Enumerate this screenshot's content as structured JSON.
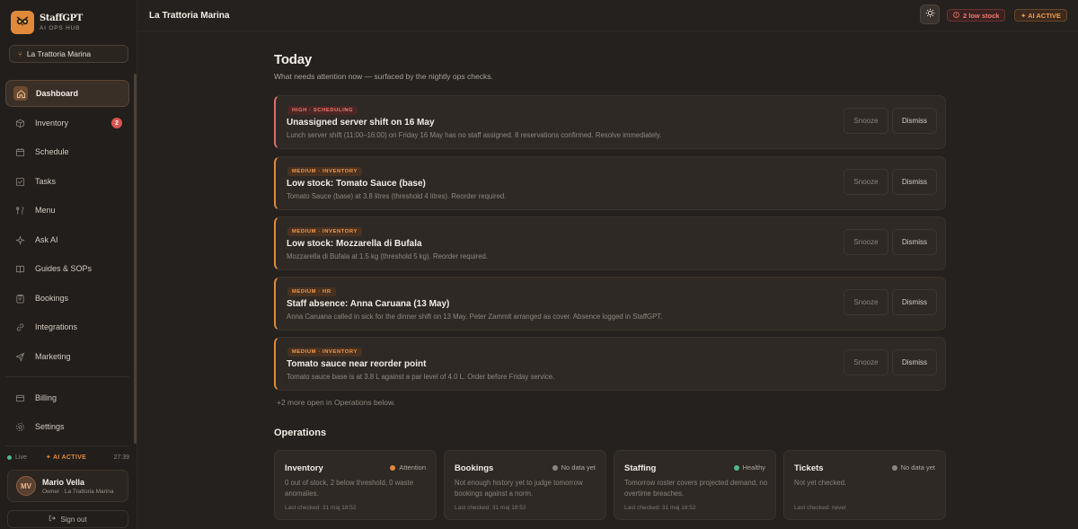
{
  "brand": {
    "name": "StaffGPT",
    "subtitle": "AI OPS HUB"
  },
  "venue_selector": {
    "value": "La Trattoria Marina",
    "icon": "fork-knife-icon"
  },
  "nav": [
    {
      "label": "Dashboard",
      "icon": "home-icon",
      "active": true
    },
    {
      "label": "Inventory",
      "icon": "box-icon",
      "badge": "2"
    },
    {
      "label": "Schedule",
      "icon": "calendar-icon"
    },
    {
      "label": "Tasks",
      "icon": "checklist-icon"
    },
    {
      "label": "Menu",
      "icon": "fork-knife-icon"
    },
    {
      "label": "Ask AI",
      "icon": "sparkle-icon"
    },
    {
      "label": "Guides & SOPs",
      "icon": "book-icon"
    },
    {
      "label": "Bookings",
      "icon": "clipboard-icon"
    },
    {
      "label": "Integrations",
      "icon": "link-icon"
    },
    {
      "label": "Marketing",
      "icon": "send-icon"
    },
    {
      "label": "Billing",
      "icon": "card-icon"
    },
    {
      "label": "Settings",
      "icon": "gear-icon"
    }
  ],
  "status": {
    "live": "Live",
    "ai": "✦ AI ACTIVE",
    "clock": "27:39"
  },
  "user": {
    "initials": "MV",
    "name": "Mario Vella",
    "role": "Owner · La Trattoria Marina"
  },
  "sign_out": "Sign out",
  "topbar": {
    "title": "La Trattoria Marina",
    "low_stock": "2 low stock",
    "ai_active": "✦ AI ACTIVE"
  },
  "today": {
    "title": "Today",
    "subtitle": "What needs attention now — surfaced by the nightly ops checks.",
    "alerts": [
      {
        "tag": "HIGH · SCHEDULING",
        "title": "Unassigned server shift on 16 May",
        "desc": "Lunch server shift (11:00–16:00) on Friday 16 May has no staff assigned. 8 reservations confirmed. Resolve immediately.",
        "snooze": "Snooze",
        "dismiss": "Dismiss"
      },
      {
        "tag": "MEDIUM · INVENTORY",
        "title": "Low stock: Tomato Sauce (base)",
        "desc": "Tomato Sauce (base) at 3.8 litres (threshold 4 litres). Reorder required.",
        "snooze": "Snooze",
        "dismiss": "Dismiss"
      },
      {
        "tag": "MEDIUM · INVENTORY",
        "title": "Low stock: Mozzarella di Bufala",
        "desc": "Mozzarella di Bufala at 1.5 kg (threshold 5 kg). Reorder required.",
        "snooze": "Snooze",
        "dismiss": "Dismiss"
      },
      {
        "tag": "MEDIUM · HR",
        "title": "Staff absence: Anna Caruana (13 May)",
        "desc": "Anna Caruana called in sick for the dinner shift on 13 May. Peter Zammit arranged as cover. Absence logged in StaffGPT.",
        "snooze": "Snooze",
        "dismiss": "Dismiss"
      },
      {
        "tag": "MEDIUM · INVENTORY",
        "title": "Tomato sauce near reorder point",
        "desc": "Tomato sauce base is at 3.8 L against a par level of 4.0 L. Order before Friday service.",
        "snooze": "Snooze",
        "dismiss": "Dismiss"
      }
    ],
    "more_note": "+2 more open in Operations below."
  },
  "operations": {
    "title": "Operations",
    "cards": [
      {
        "title": "Inventory",
        "status": "Attention",
        "status_color": "#e0893a",
        "desc": "0 out of stock, 2 below threshold, 0 waste anomalies.",
        "checked": "Last checked: 31 maj 18:52"
      },
      {
        "title": "Bookings",
        "status": "No data yet",
        "status_color": "#8d8680",
        "desc": "Not enough history yet to judge tomorrow bookings against a norm.",
        "checked": "Last checked: 31 maj 18:52"
      },
      {
        "title": "Staffing",
        "status": "Healthy",
        "status_color": "#4fb98a",
        "desc": "Tomorrow roster covers projected demand, no overtime breaches.",
        "checked": "Last checked: 31 maj 18:52"
      },
      {
        "title": "Tickets",
        "status": "No data yet",
        "status_color": "#8d8680",
        "desc": "Not yet checked.",
        "checked": "Last checked: never"
      }
    ]
  }
}
